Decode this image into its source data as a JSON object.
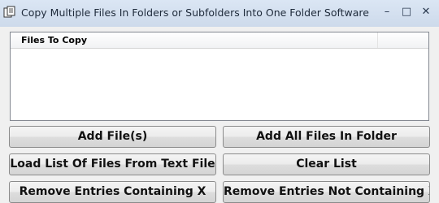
{
  "window": {
    "title": "Copy Multiple Files In Folders or Subfolders Into One Folder Software",
    "icon": "app-icon",
    "controls": {
      "minimize": "–",
      "maximize": "□",
      "close": "✕"
    }
  },
  "file_list": {
    "columns": [
      "Files To Copy",
      ""
    ],
    "rows": []
  },
  "buttons": {
    "add_files": "Add File(s)",
    "add_all_in_folder": "Add All Files In Folder",
    "load_list": "Load List Of Files From Text File",
    "clear_list": "Clear List",
    "remove_containing": "Remove Entries Containing X",
    "remove_not_containing": "Remove Entries Not Containing X"
  }
}
